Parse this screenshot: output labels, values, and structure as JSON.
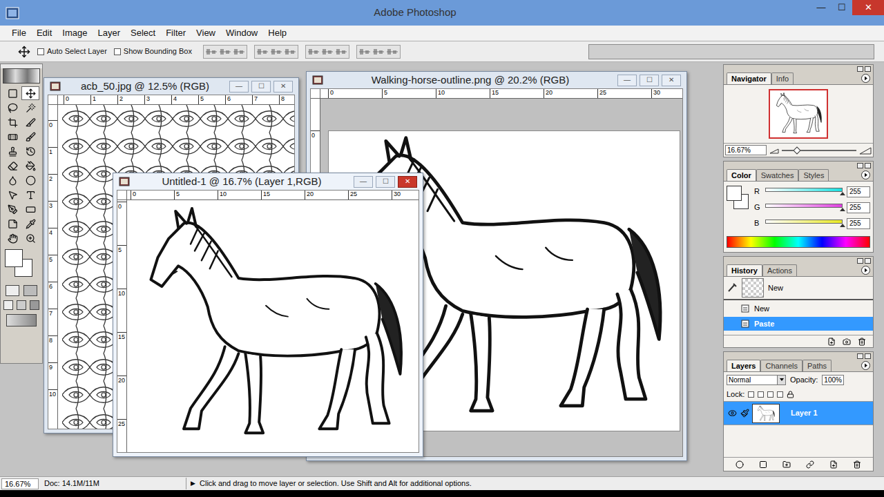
{
  "app_window": {
    "title": "Adobe Photoshop",
    "controls": [
      "—",
      "☐",
      "✕"
    ]
  },
  "menu": [
    "File",
    "Edit",
    "Image",
    "Layer",
    "Select",
    "Filter",
    "View",
    "Window",
    "Help"
  ],
  "options_bar": {
    "checkboxes": [
      {
        "label": "Auto Select Layer",
        "checked": false
      },
      {
        "label": "Show Bounding Box",
        "checked": false
      }
    ]
  },
  "doc_window_controls": [
    "—",
    "☐",
    "✕"
  ],
  "documents": [
    {
      "title": "acb_50.jpg @ 12.5% (RGB)",
      "active": false,
      "kind": "pattern",
      "ruler_top": [
        "0",
        "1",
        "2",
        "3",
        "4",
        "5",
        "6",
        "7",
        "8"
      ],
      "ruler_left": [
        "0",
        "1",
        "2",
        "3",
        "4",
        "5",
        "6",
        "7",
        "8",
        "9",
        "10"
      ]
    },
    {
      "title": "Walking-horse-outline.png @ 20.2% (RGB)",
      "active": false,
      "kind": "page",
      "ruler_top": [
        "0",
        "5",
        "10",
        "15",
        "20",
        "25",
        "30"
      ],
      "ruler_left": [
        "0"
      ]
    },
    {
      "title": "Untitled-1 @ 16.7% (Layer 1,RGB)",
      "active": true,
      "kind": "layer",
      "ruler_top": [
        "0",
        "5",
        "10",
        "15",
        "20",
        "25",
        "30"
      ],
      "ruler_left": [
        "0",
        "5",
        "10",
        "15",
        "20",
        "25"
      ]
    }
  ],
  "navigator": {
    "tabs": [
      {
        "label": "Navigator",
        "selected": true
      },
      {
        "label": "Info",
        "selected": false
      }
    ],
    "zoom": "16.67%",
    "level": 0.2
  },
  "color": {
    "tabs": [
      {
        "label": "Color",
        "selected": true
      },
      {
        "label": "Swatches",
        "selected": false
      },
      {
        "label": "Styles",
        "selected": false
      }
    ],
    "channels": [
      {
        "name": "R",
        "value": "255",
        "level": 1,
        "color": "#18e0e0"
      },
      {
        "name": "G",
        "value": "255",
        "level": 1,
        "color": "#e040e0"
      },
      {
        "name": "B",
        "value": "255",
        "level": 1,
        "color": "#e8e820"
      }
    ]
  },
  "history": {
    "tabs": [
      {
        "label": "History",
        "selected": true
      },
      {
        "label": "Actions",
        "selected": false
      }
    ],
    "snapshot": "New",
    "items": [
      {
        "label": "New",
        "selected": false
      },
      {
        "label": "Paste",
        "selected": true
      }
    ]
  },
  "layers": {
    "tabs": [
      {
        "label": "Layers",
        "selected": true
      },
      {
        "label": "Channels",
        "selected": false
      },
      {
        "label": "Paths",
        "selected": false
      }
    ],
    "blend_mode": "Normal",
    "opacity_label": "Opacity:",
    "opacity": "100%",
    "lock_label": "Lock:",
    "items": [
      {
        "name": "Layer 1",
        "visible": true,
        "selected": true
      }
    ]
  },
  "status_bar": {
    "zoom": "16.67%",
    "doc": "Doc: 14.1M/11M",
    "arrow": "▶",
    "hint": "Click and drag to move layer or selection. Use Shift and Alt for additional options."
  }
}
